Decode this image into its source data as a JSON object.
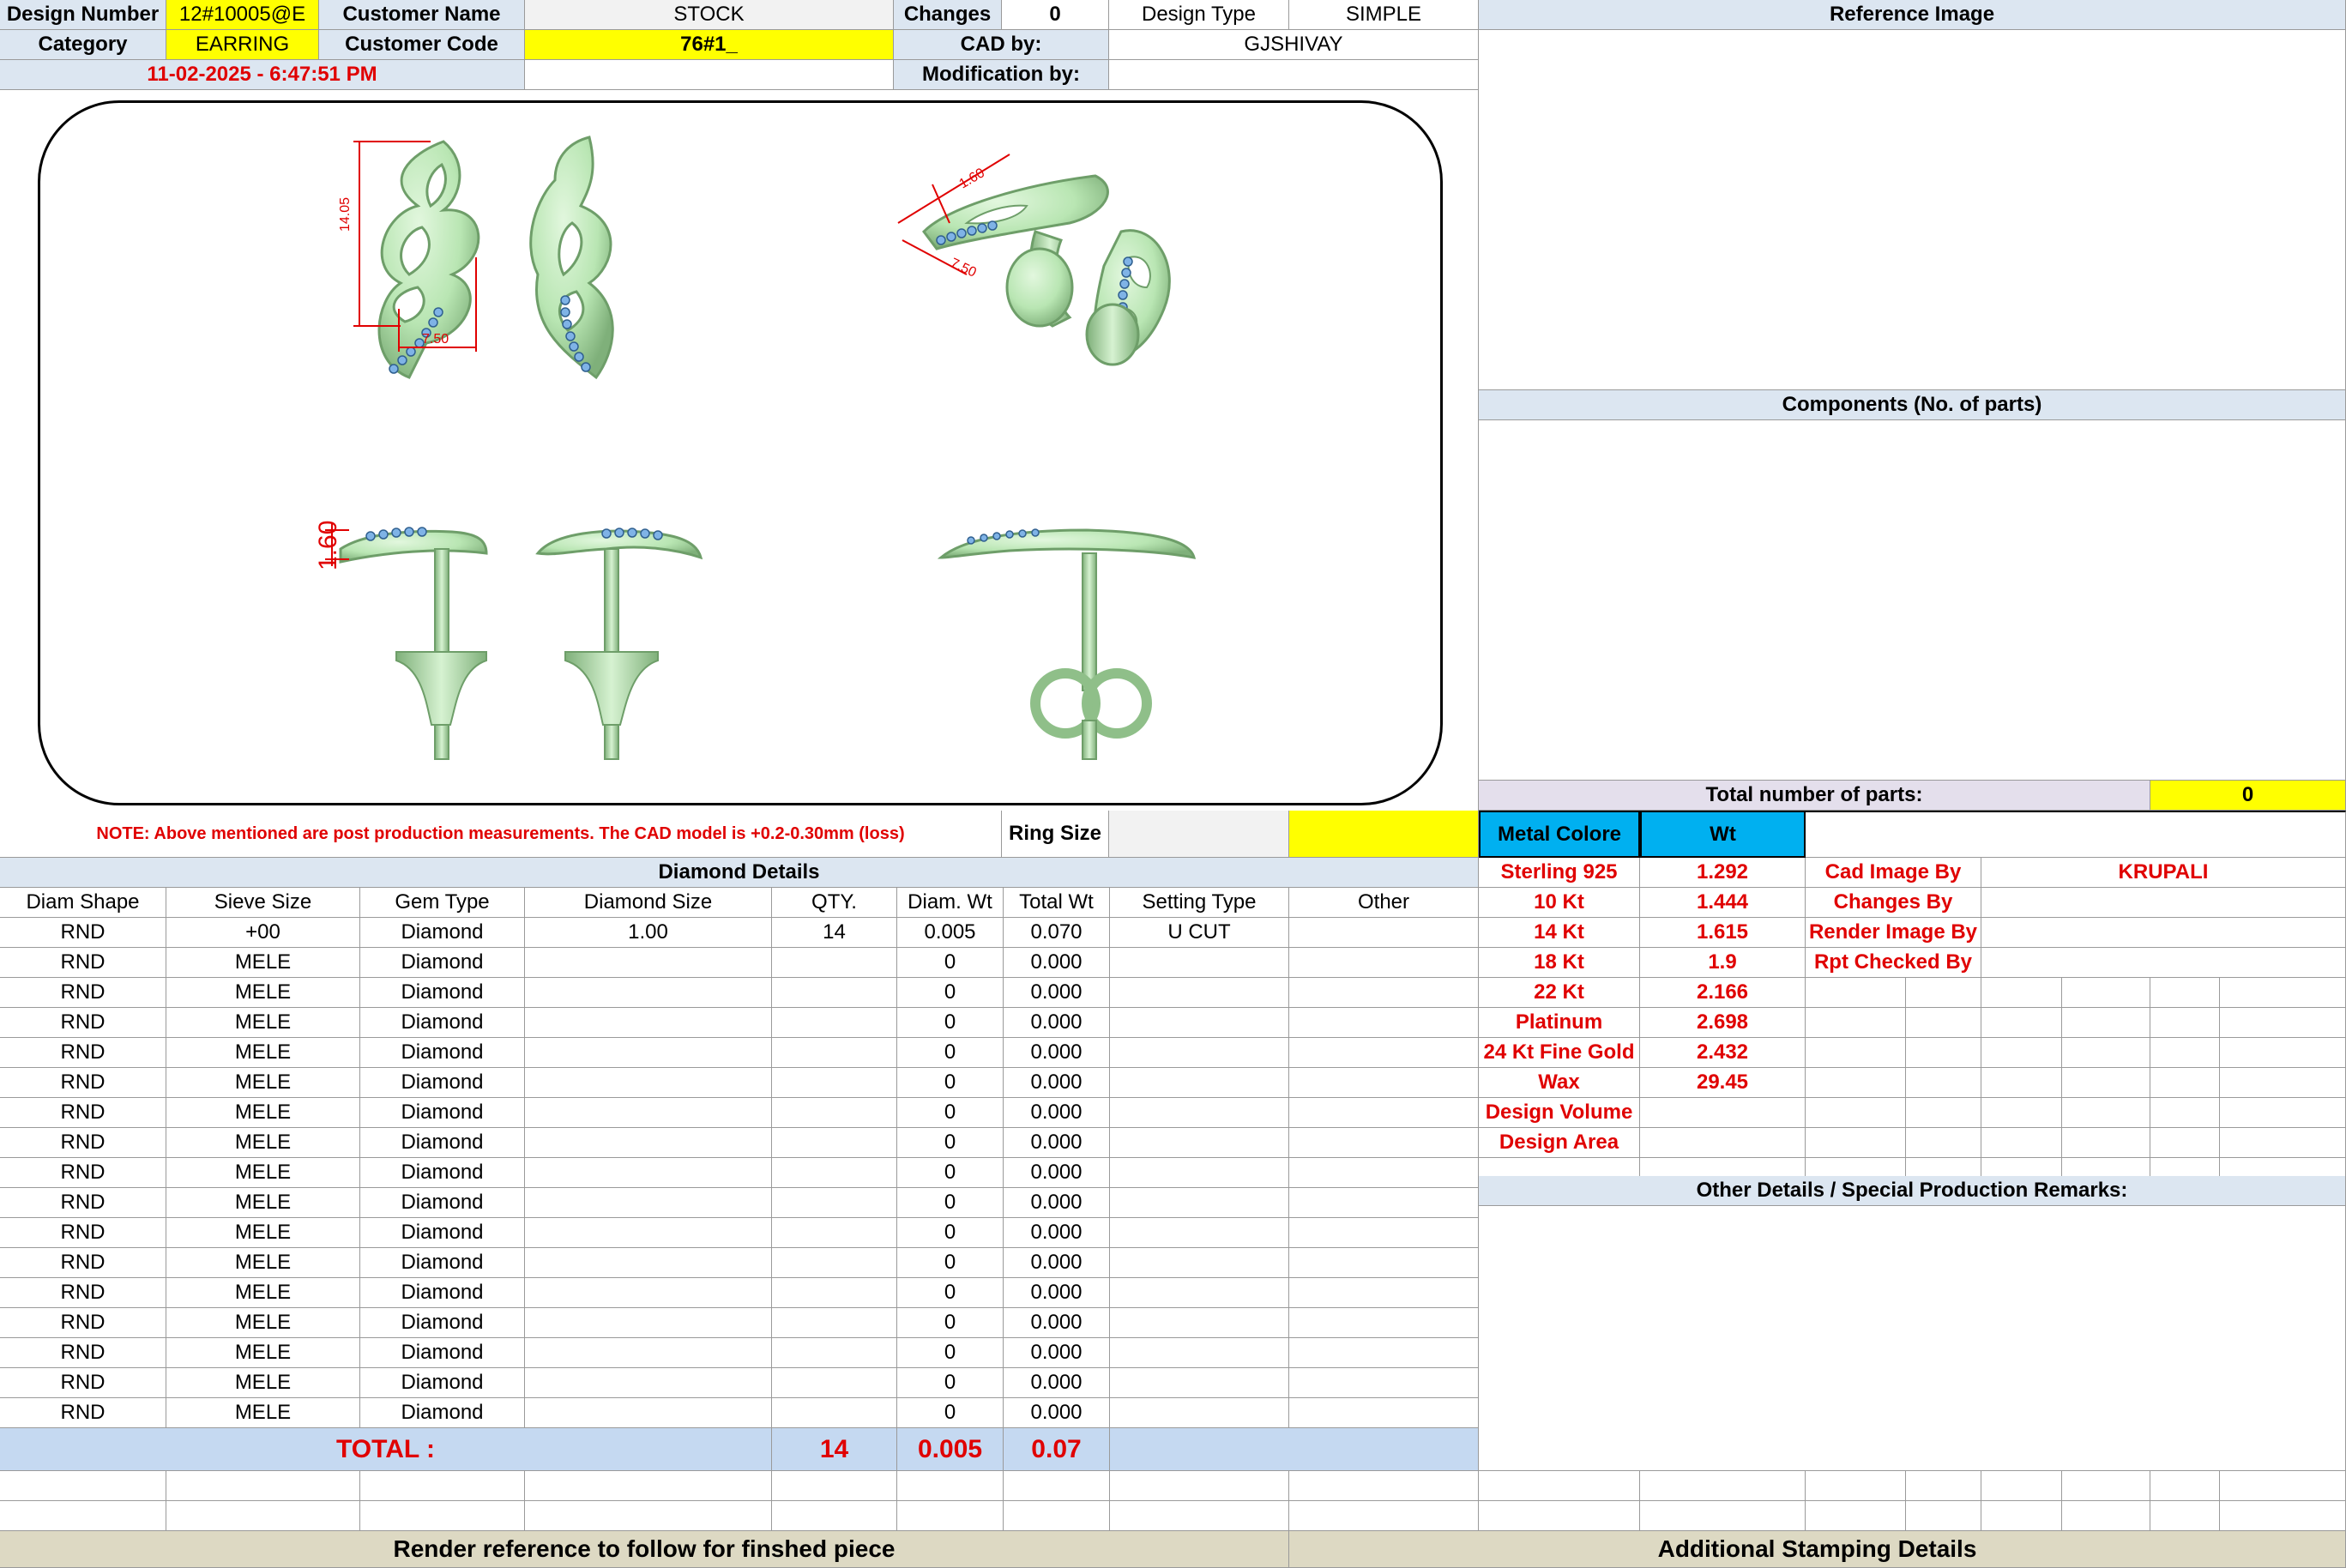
{
  "header": {
    "design_number_label": "Design Number",
    "design_number": "12#10005@E",
    "customer_name_label": "Customer Name",
    "customer_name": "STOCK",
    "changes_label": "Changes",
    "changes": "0",
    "design_type_label": "Design Type",
    "design_type": "SIMPLE",
    "reference_image_label": "Reference Image",
    "category_label": "Category",
    "category": "EARRING",
    "customer_code_label": "Customer Code",
    "customer_code": "76#1_",
    "cad_by_label": "CAD by:",
    "cad_by": "GJSHIVAY",
    "datetime": "11-02-2025 - 6:47:51 PM",
    "modification_by_label": "Modification by:"
  },
  "drawing": {
    "dim_height": "14.05",
    "dim_width": "7.50",
    "dim_side": "1.60",
    "dim_persp_a": "1.60",
    "dim_persp_b": "7.50"
  },
  "components_label": "Components (No. of parts)",
  "total_parts_label": "Total number of parts:",
  "total_parts": "0",
  "note": "NOTE: Above mentioned are post production measurements. The CAD model is +0.2-0.30mm (loss)",
  "ring_size_label": "Ring Size",
  "metal": {
    "header_colore": "Metal Colore",
    "header_wt": "Wt",
    "rows": [
      {
        "name": "Sterling 925",
        "wt": "1.292"
      },
      {
        "name": "10 Kt",
        "wt": "1.444"
      },
      {
        "name": "14 Kt",
        "wt": "1.615"
      },
      {
        "name": "18 Kt",
        "wt": "1.9"
      },
      {
        "name": "22 Kt",
        "wt": "2.166"
      },
      {
        "name": "Platinum",
        "wt": "2.698"
      },
      {
        "name": "24 Kt Fine Gold",
        "wt": "2.432"
      },
      {
        "name": "Wax",
        "wt": "29.45"
      },
      {
        "name": "Design Volume",
        "wt": ""
      },
      {
        "name": "Design Area",
        "wt": ""
      }
    ]
  },
  "credits": [
    {
      "label": "Cad Image By",
      "value": "KRUPALI"
    },
    {
      "label": "Changes By",
      "value": ""
    },
    {
      "label": "Render Image By",
      "value": ""
    },
    {
      "label": "Rpt Checked By",
      "value": ""
    }
  ],
  "diamond": {
    "title": "Diamond Details",
    "columns": [
      "Diam Shape",
      "Sieve Size",
      "Gem Type",
      "Diamond Size",
      "QTY.",
      "Diam. Wt",
      "Total Wt",
      "Setting Type",
      "Other"
    ],
    "rows": [
      [
        "RND",
        "+00",
        "Diamond",
        "1.00",
        "14",
        "0.005",
        "0.070",
        "U CUT",
        ""
      ],
      [
        "RND",
        "MELE",
        "Diamond",
        "",
        "",
        "0",
        "0.000",
        "",
        ""
      ],
      [
        "RND",
        "MELE",
        "Diamond",
        "",
        "",
        "0",
        "0.000",
        "",
        ""
      ],
      [
        "RND",
        "MELE",
        "Diamond",
        "",
        "",
        "0",
        "0.000",
        "",
        ""
      ],
      [
        "RND",
        "MELE",
        "Diamond",
        "",
        "",
        "0",
        "0.000",
        "",
        ""
      ],
      [
        "RND",
        "MELE",
        "Diamond",
        "",
        "",
        "0",
        "0.000",
        "",
        ""
      ],
      [
        "RND",
        "MELE",
        "Diamond",
        "",
        "",
        "0",
        "0.000",
        "",
        ""
      ],
      [
        "RND",
        "MELE",
        "Diamond",
        "",
        "",
        "0",
        "0.000",
        "",
        ""
      ],
      [
        "RND",
        "MELE",
        "Diamond",
        "",
        "",
        "0",
        "0.000",
        "",
        ""
      ],
      [
        "RND",
        "MELE",
        "Diamond",
        "",
        "",
        "0",
        "0.000",
        "",
        ""
      ],
      [
        "RND",
        "MELE",
        "Diamond",
        "",
        "",
        "0",
        "0.000",
        "",
        ""
      ],
      [
        "RND",
        "MELE",
        "Diamond",
        "",
        "",
        "0",
        "0.000",
        "",
        ""
      ],
      [
        "RND",
        "MELE",
        "Diamond",
        "",
        "",
        "0",
        "0.000",
        "",
        ""
      ],
      [
        "RND",
        "MELE",
        "Diamond",
        "",
        "",
        "0",
        "0.000",
        "",
        ""
      ],
      [
        "RND",
        "MELE",
        "Diamond",
        "",
        "",
        "0",
        "0.000",
        "",
        ""
      ],
      [
        "RND",
        "MELE",
        "Diamond",
        "",
        "",
        "0",
        "0.000",
        "",
        ""
      ],
      [
        "RND",
        "MELE",
        "Diamond",
        "",
        "",
        "0",
        "0.000",
        "",
        ""
      ]
    ],
    "total_label": "TOTAL :",
    "total_qty": "14",
    "total_diam_wt": "0.005",
    "total_wt": "0.07"
  },
  "other_details_label": "Other Details / Special Production Remarks:",
  "render_reference_label": "Render reference to follow for finshed piece",
  "stamping_label": "Additional Stamping Details",
  "colors": {
    "highlight_yellow": "#ffff00",
    "header_blue": "#dce6f1",
    "metal_header_blue": "#00b0f0",
    "total_blue": "#c5d9f1",
    "label_red": "#e00000",
    "model_green": "#b9e6b3",
    "stone_blue": "#7fb3e6",
    "footer_tan": "#ddd9c3"
  }
}
